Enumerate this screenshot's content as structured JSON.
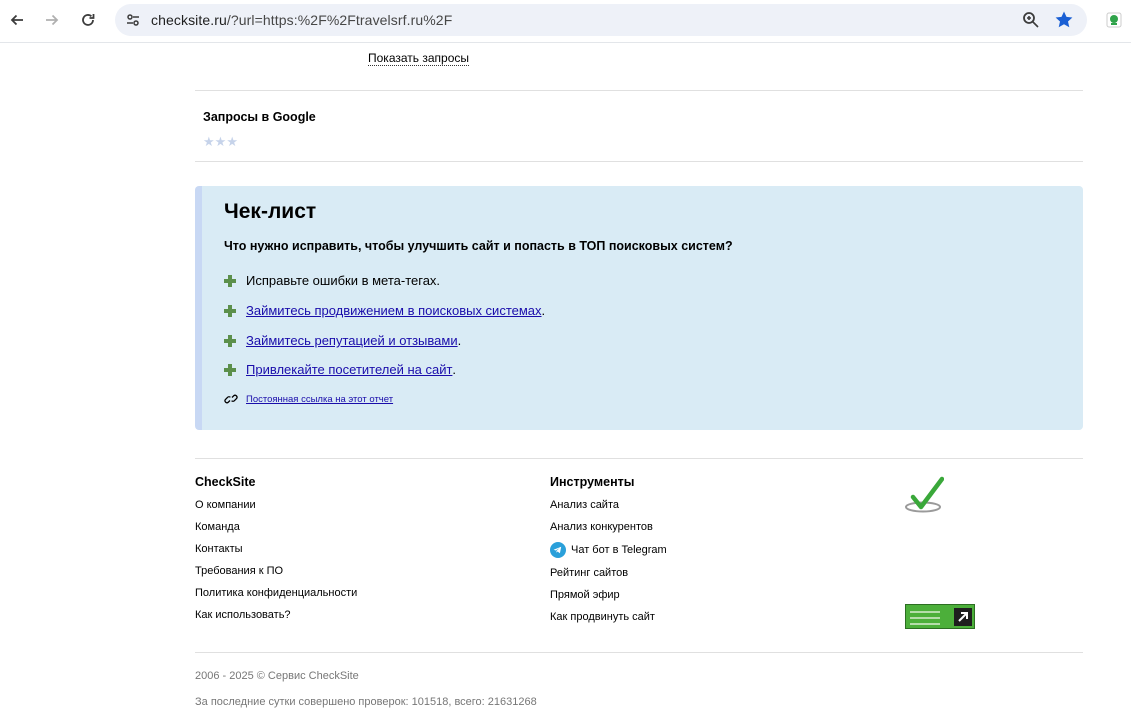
{
  "browser": {
    "url_host": "checksite.ru",
    "url_rest": "/?url=https:%2F%2Ftravelsrf.ru%2F"
  },
  "top": {
    "show_queries_label": "Показать запросы"
  },
  "google_queries": {
    "title": "Запросы в Google",
    "stars_filled": 0,
    "stars_total": 3
  },
  "checklist": {
    "title": "Чек-лист",
    "question": "Что нужно исправить, чтобы улучшить сайт и попасть в ТОП поисковых систем?",
    "items": [
      {
        "text": "Исправьте ошибки в мета-тегах.",
        "link": "",
        "suffix": ""
      },
      {
        "text": "",
        "link": "Займитесь продвижением в поисковых системах",
        "suffix": "."
      },
      {
        "text": "",
        "link": "Займитесь репутацией и отзывами",
        "suffix": "."
      },
      {
        "text": "",
        "link": "Привлекайте посетителей на сайт",
        "suffix": "."
      }
    ],
    "permalink_label": "Постоянная ссылка на этот отчет"
  },
  "footer": {
    "col1": {
      "title": "CheckSite",
      "links": [
        "О компании",
        "Команда",
        "Контакты",
        "Требования к ПО",
        "Политика конфиденциальности",
        "Как использовать?"
      ]
    },
    "col2": {
      "title": "Инструменты",
      "links": [
        "Анализ сайта",
        "Анализ конкурентов",
        "Чат бот в Telegram",
        "Рейтинг сайтов",
        "Прямой эфир",
        "Как продвинуть сайт"
      ]
    },
    "copyright": "2006 - 2025 © Сервис CheckSite",
    "stats": "За последние сутки совершено проверок: 101518, всего: 21631268"
  },
  "colors": {
    "link": "#1a0dab",
    "checklist_bg": "#d9ebf5",
    "plus_green": "#5b8f4b",
    "star_empty": "#c6d3ea"
  }
}
